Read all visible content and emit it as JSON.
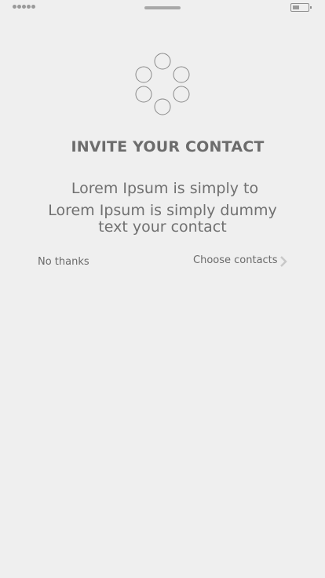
{
  "status_bar": {
    "signal_dots": 5,
    "battery_level": 0.45
  },
  "invite": {
    "title": "INVITE YOUR CONTACT",
    "line1": "Lorem Ipsum is simply to",
    "line2": "Lorem Ipsum is simply dummy text your contact"
  },
  "actions": {
    "no_thanks_label": "No thanks",
    "choose_contacts_label": "Choose contacts"
  },
  "icons": {
    "loader": "loading-circles-icon",
    "chevron": "chevron-right-icon"
  },
  "colors": {
    "background": "#efefef",
    "text": "#6b6b6b",
    "icon_stroke": "#8a8a8a",
    "chevron": "#c8c8c8"
  }
}
